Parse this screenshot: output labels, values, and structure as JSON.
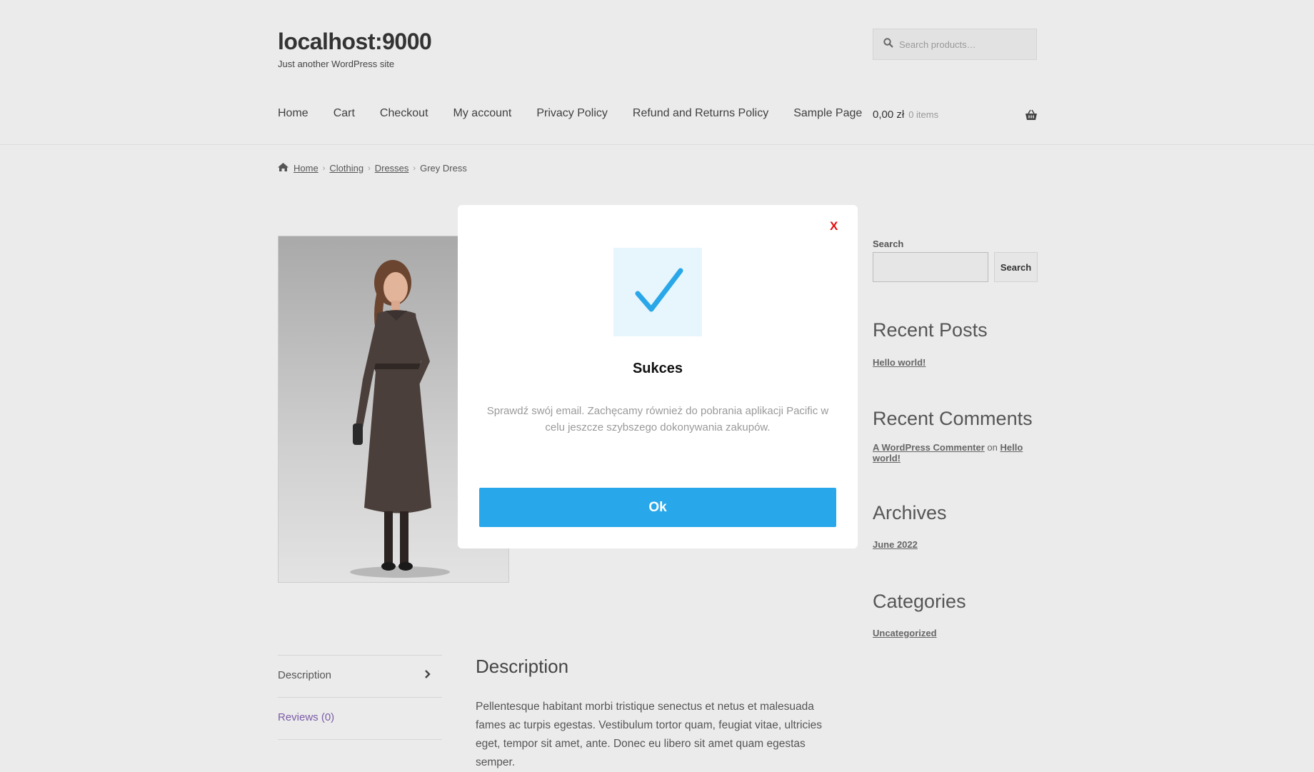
{
  "site": {
    "title": "localhost:9000",
    "tagline": "Just another WordPress site"
  },
  "search": {
    "placeholder": "Search products…"
  },
  "nav": {
    "items": [
      "Home",
      "Cart",
      "Checkout",
      "My account",
      "Privacy Policy",
      "Refund and Returns Policy",
      "Sample Page"
    ]
  },
  "cart": {
    "total": "0,00 zł",
    "items": "0 items"
  },
  "breadcrumb": {
    "home": "Home",
    "clothing": "Clothing",
    "dresses": "Dresses",
    "current": "Grey Dress"
  },
  "sidebar": {
    "search_label": "Search",
    "search_button": "Search",
    "recent_posts_title": "Recent Posts",
    "recent_post": "Hello world!",
    "recent_comments_title": "Recent Comments",
    "comment_author": "A WordPress Commenter",
    "comment_on": "on",
    "comment_post_line1": "Hello",
    "comment_post_line2": "world!",
    "archives_title": "Archives",
    "archive_item": "June 2022",
    "categories_title": "Categories",
    "category_item": "Uncategorized"
  },
  "tabs": {
    "description": "Description",
    "reviews": "Reviews (0)"
  },
  "description": {
    "title": "Description",
    "body": "Pellentesque habitant morbi tristique senectus et netus et malesuada fames ac turpis egestas. Vestibulum tortor quam, feugiat vitae, ultricies eget, tempor sit amet, ante. Donec eu libero sit amet quam egestas semper."
  },
  "modal": {
    "close": "X",
    "title": "Sukces",
    "message": "Sprawdź swój email. Zachęcamy również do pobrania aplikacji Pacific w celu jeszcze szybszego dokonywania zakupów.",
    "ok": "Ok"
  },
  "colors": {
    "page_bg": "#ebebeb",
    "accent": "#28a8ea",
    "close": "#e30d0d",
    "check_bg": "#e7f5fd",
    "reviews_link": "#7b5ba6"
  },
  "icons": [
    "search-icon",
    "cart-basket-icon",
    "home-icon",
    "chevron-right-icon",
    "checkmark-icon"
  ]
}
